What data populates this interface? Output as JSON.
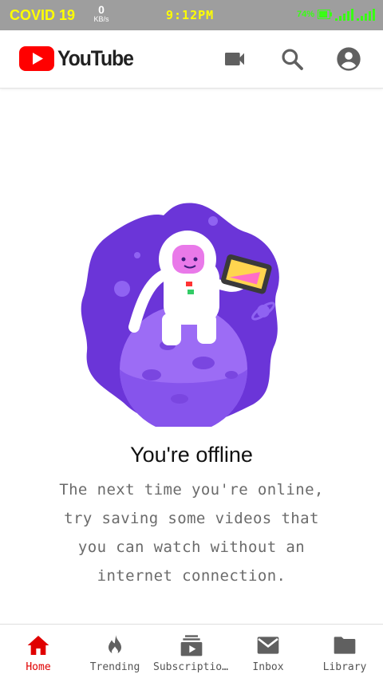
{
  "status_bar": {
    "carrier_text": "COVID 19",
    "net_speed_value": "0",
    "net_speed_unit": "KB/s",
    "time": "9:12PM",
    "battery_text": "74%"
  },
  "app_bar": {
    "logo_text": "YouTube",
    "icons": [
      "video-camera-icon",
      "search-icon",
      "account-icon"
    ]
  },
  "offline": {
    "title": "You're offline",
    "message": "The next time you're online, try saving some videos that you can watch without an internet connection."
  },
  "bottom_nav": {
    "items": [
      {
        "label": "Home",
        "icon": "home-icon",
        "active": true
      },
      {
        "label": "Trending",
        "icon": "flame-icon",
        "active": false
      },
      {
        "label": "Subscriptions",
        "icon": "subscriptions-icon",
        "active": false
      },
      {
        "label": "Inbox",
        "icon": "mail-icon",
        "active": false
      },
      {
        "label": "Library",
        "icon": "folder-icon",
        "active": false
      }
    ]
  },
  "colors": {
    "brand_red": "#ff0000",
    "active_nav": "#e00000",
    "status_bar_bg": "#9e9e9e",
    "status_text": "#ffff00",
    "icon_gray": "#606060",
    "illustration_purple": "#6b35d8"
  }
}
